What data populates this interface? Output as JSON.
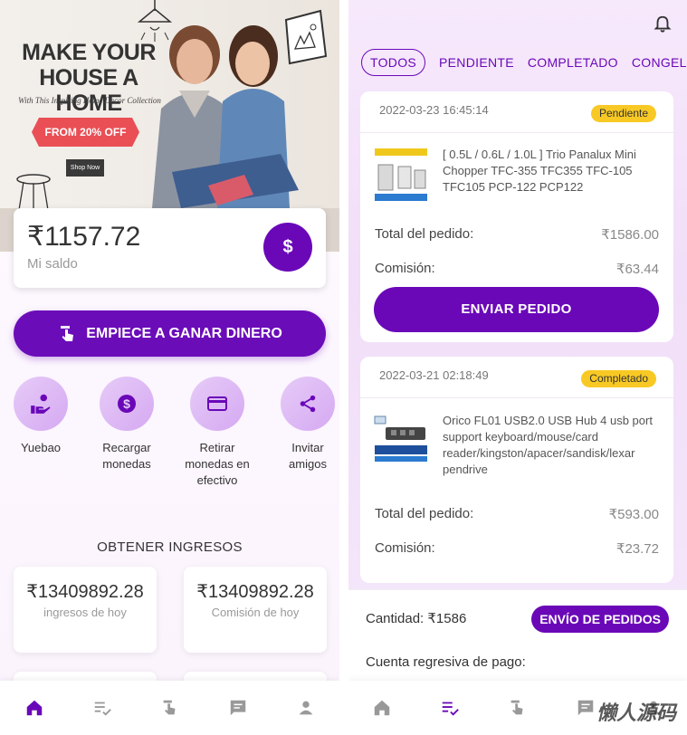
{
  "banner": {
    "headline_1": "MAKE YOUR",
    "headline_2": "HOUSE A HOME",
    "subline": "With This Inspiring Home Decor Collection",
    "tag": "FROM 20% OFF",
    "shop": "Shop Now"
  },
  "balance": {
    "amount": "₹1157.72",
    "label": "Mi saldo",
    "icon": "dollar-icon"
  },
  "earn_button": "EMPIECE A GANAR DINERO",
  "quick_actions": [
    {
      "label": "Yuebao",
      "icon": "hand-coins-icon"
    },
    {
      "label": "Recargar monedas",
      "icon": "dollar-circle-icon"
    },
    {
      "label": "Retirar monedas en efectivo",
      "icon": "card-icon"
    },
    {
      "label": "Invitar amigos",
      "icon": "share-icon"
    }
  ],
  "income": {
    "title": "OBTENER INGRESOS",
    "today_income_value": "₹13409892.28",
    "today_income_label": "ingresos de hoy",
    "today_commission_value": "₹13409892.28",
    "today_commission_label": "Comisión de hoy"
  },
  "filters": [
    "TODOS",
    "PENDIENTE",
    "COMPLETADO",
    "CONGELANI"
  ],
  "orders": [
    {
      "time": "2022-03-23 16:45:14",
      "status": "Pendiente",
      "product": "[ 0.5L / 0.6L / 1.0L ] Trio Panalux Mini Chopper TFC-355 TFC355 TFC-105 TFC105 PCP-122 PCP122",
      "total_label": "Total del pedido:",
      "total": "₹1586.00",
      "commission_label": "Comisión:",
      "commission": "₹63.44",
      "button": "ENVIAR PEDIDO"
    },
    {
      "time": "2022-03-21 02:18:49",
      "status": "Completado",
      "product": "Orico FL01 USB2.0 USB Hub 4 usb port support keyboard/mouse/card reader/kingston/apacer/sandisk/lexar pendrive",
      "total_label": "Total del pedido:",
      "total": "₹593.00",
      "commission_label": "Comisión:",
      "commission": "₹23.72"
    }
  ],
  "footer": {
    "quantity_label": "Cantidad:",
    "quantity_value": "₹1586",
    "send_all": "ENVÍO DE PEDIDOS",
    "countdown": "Cuenta regresiva de pago:"
  },
  "tabs": [
    "home-icon",
    "list-check-icon",
    "tap-hand-icon",
    "message-icon",
    "person-icon"
  ],
  "colors": {
    "accent": "#6a08b8",
    "pending": "#f8c924"
  },
  "watermark": "懒人源码"
}
